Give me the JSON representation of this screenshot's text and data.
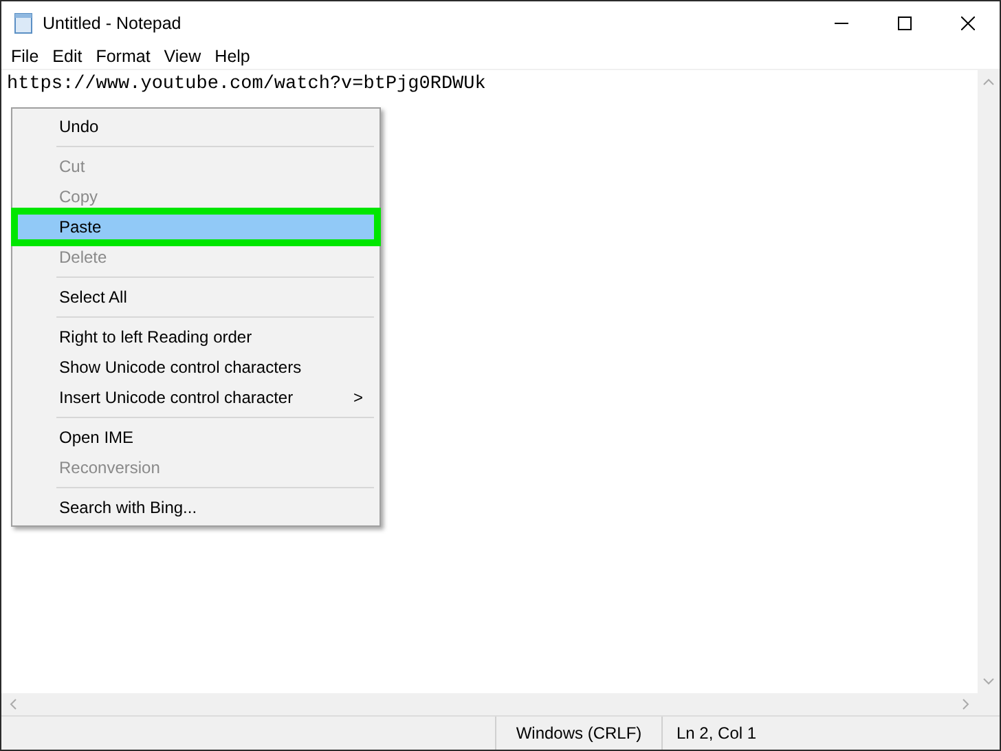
{
  "window": {
    "title": "Untitled - Notepad"
  },
  "menu_bar": [
    {
      "label": "File"
    },
    {
      "label": "Edit"
    },
    {
      "label": "Format"
    },
    {
      "label": "View"
    },
    {
      "label": "Help"
    }
  ],
  "editor": {
    "text": "https://www.youtube.com/watch?v=btPjg0RDWUk"
  },
  "context_menu": [
    {
      "kind": "item",
      "label": "Undo",
      "disabled": false,
      "selected": false,
      "annotated": false
    },
    {
      "kind": "separator"
    },
    {
      "kind": "item",
      "label": "Cut",
      "disabled": true,
      "selected": false,
      "annotated": false
    },
    {
      "kind": "item",
      "label": "Copy",
      "disabled": true,
      "selected": false,
      "annotated": false
    },
    {
      "kind": "item",
      "label": "Paste",
      "disabled": false,
      "selected": true,
      "annotated": true
    },
    {
      "kind": "item",
      "label": "Delete",
      "disabled": true,
      "selected": false,
      "annotated": false
    },
    {
      "kind": "separator"
    },
    {
      "kind": "item",
      "label": "Select All",
      "disabled": false,
      "selected": false,
      "annotated": false
    },
    {
      "kind": "separator"
    },
    {
      "kind": "item",
      "label": "Right to left Reading order",
      "disabled": false,
      "selected": false,
      "annotated": false
    },
    {
      "kind": "item",
      "label": "Show Unicode control characters",
      "disabled": false,
      "selected": false,
      "annotated": false
    },
    {
      "kind": "item",
      "label": "Insert Unicode control character",
      "disabled": false,
      "selected": false,
      "annotated": false,
      "submenu": ">"
    },
    {
      "kind": "separator"
    },
    {
      "kind": "item",
      "label": "Open IME",
      "disabled": false,
      "selected": false,
      "annotated": false
    },
    {
      "kind": "item",
      "label": "Reconversion",
      "disabled": true,
      "selected": false,
      "annotated": false
    },
    {
      "kind": "separator"
    },
    {
      "kind": "item",
      "label": "Search with Bing...",
      "disabled": false,
      "selected": false,
      "annotated": false
    }
  ],
  "status_bar": [
    {
      "text": "Windows (CRLF)"
    },
    {
      "text": "Ln 2, Col 1"
    }
  ]
}
